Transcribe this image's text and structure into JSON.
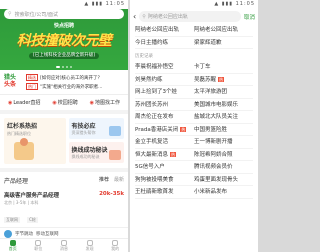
{
  "left": {
    "status": {
      "time": "",
      "icons": "▲ ▮▮▮ 11:05"
    },
    "search_placeholder": "搜索职位/公司/面试",
    "brand": "快点招聘",
    "banner": "科技撞破次元壁",
    "banner_sub": "[已上线科技企业品牌全新升级]",
    "news_tag_top": "猎头",
    "news_tag_bottom": "头条",
    "news": [
      {
        "badge": "精选",
        "text": "[如何应对]核心员工的离开了？"
      },
      {
        "badge": "热门",
        "text": "\"实施\"相关行业的海外求职者..."
      }
    ],
    "quick": [
      {
        "icon": "◉",
        "label": "Leader直招"
      },
      {
        "icon": "◉",
        "label": "校园招聘"
      },
      {
        "icon": "◉",
        "label": "地图找工作"
      }
    ],
    "card_big": {
      "title": "红杉系热招",
      "desc": "热门精选职位"
    },
    "card_a": {
      "title": "有技必应",
      "desc": "资深猎头帮你"
    },
    "card_b": {
      "title": "换线成功秘诀",
      "desc": "换线成功的秘诀"
    },
    "section_title": "产品经理",
    "section_tabs": [
      "推荐",
      "最新"
    ],
    "job": {
      "title": "高级客户服务产品经理",
      "salary": "20k-35k",
      "meta": "北京 | 3-5年 | 本科",
      "tags": [
        "互联网",
        "C轮"
      ]
    },
    "job2": {
      "company": "字节跳动",
      "meta": "移动互联网"
    },
    "tabs": [
      "首页",
      "职位",
      "消息",
      "发现",
      "我的"
    ]
  },
  "right": {
    "status": {
      "time": "",
      "icons": "▲ ▮▮▮ 11:05"
    },
    "back_icon": "‹",
    "search_value": "阿纳老公回应出轨",
    "cancel": "取消",
    "suggestions": [
      "阿纳老公回应出轨",
      "今日主播约练"
    ],
    "suggestions_right": [
      "阿纳老公回应出轨",
      "梁家辉道歉"
    ],
    "history_label": "历史记录",
    "grid": [
      {
        "text": "李晨祝福孙悟空",
        "hot": false
      },
      {
        "text": "卡丁车",
        "hot": false
      },
      {
        "text": "刘昊然约练",
        "hot": false
      },
      {
        "text": "吴磊苏醒",
        "hot": true
      },
      {
        "text": "网上捡到了3个娃",
        "hot": false
      },
      {
        "text": "太平洋旅游团",
        "hot": false
      },
      {
        "text": "苏州团长苏州",
        "hot": false
      },
      {
        "text": "美国城市电影娱乐",
        "hot": false
      },
      {
        "text": "周杰伦正在发布",
        "hot": false
      },
      {
        "text": "盐城北大队员关注",
        "hot": false
      },
      {
        "text": "Prada香港店关闭",
        "hot": true
      },
      {
        "text": "中国男篮险胜",
        "hot": false
      },
      {
        "text": "金立手机复活",
        "hot": false
      },
      {
        "text": "王一博新剧开播",
        "hot": false
      },
      {
        "text": "恒大最新消息",
        "hot": true
      },
      {
        "text": "陈冠希阿娇合照",
        "hot": false
      },
      {
        "text": "5G信号入户",
        "hot": false
      },
      {
        "text": "腾讯视频会员价",
        "hot": false
      },
      {
        "text": "狗狗被投喂美食",
        "hot": false
      },
      {
        "text": "鸡蛋里面发现骨头",
        "hot": false
      },
      {
        "text": "王杜鹃新歌首发",
        "hot": false
      },
      {
        "text": "小米新品发布",
        "hot": false
      }
    ]
  }
}
